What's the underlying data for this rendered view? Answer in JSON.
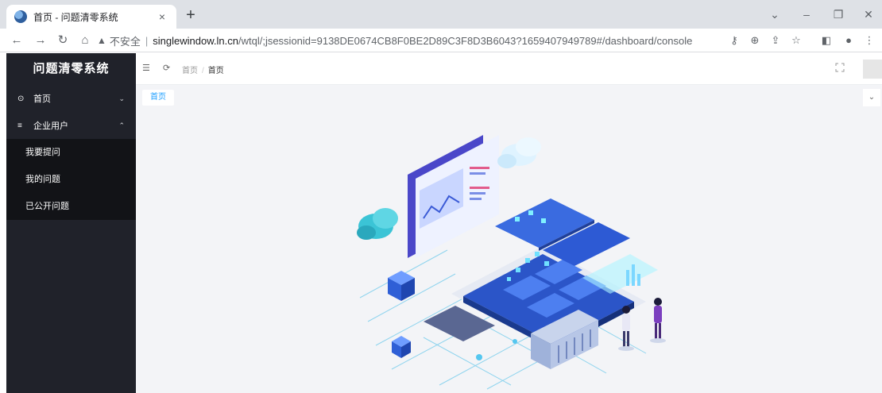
{
  "browser": {
    "tab_title": "首页 - 问题清零系统",
    "tab_close": "×",
    "new_tab": "+",
    "insecure_label": "不安全",
    "url_host": "singlewindow.ln.cn",
    "url_path": "/wtql/;jsessionid=9138DE0674CB8F0BE2D89C3F8D3B6043?1659407949789#/dashboard/console"
  },
  "app": {
    "system_name": "问题清零系统"
  },
  "sidebar": {
    "items": [
      {
        "label": "首页",
        "icon": "home-icon",
        "expanded": false
      },
      {
        "label": "企业用户",
        "icon": "menu-icon",
        "expanded": true,
        "children": [
          {
            "label": "我要提问"
          },
          {
            "label": "我的问题"
          },
          {
            "label": "已公开问题"
          }
        ]
      }
    ]
  },
  "topbar": {
    "breadcrumb": [
      "首页",
      "首页"
    ]
  },
  "page_tabs": [
    {
      "label": "首页",
      "active": true
    }
  ],
  "colors": {
    "sidebar_bg": "#20222a",
    "submenu_bg": "#121317",
    "accent": "#1e9fff",
    "content_bg": "#f3f4f7"
  }
}
